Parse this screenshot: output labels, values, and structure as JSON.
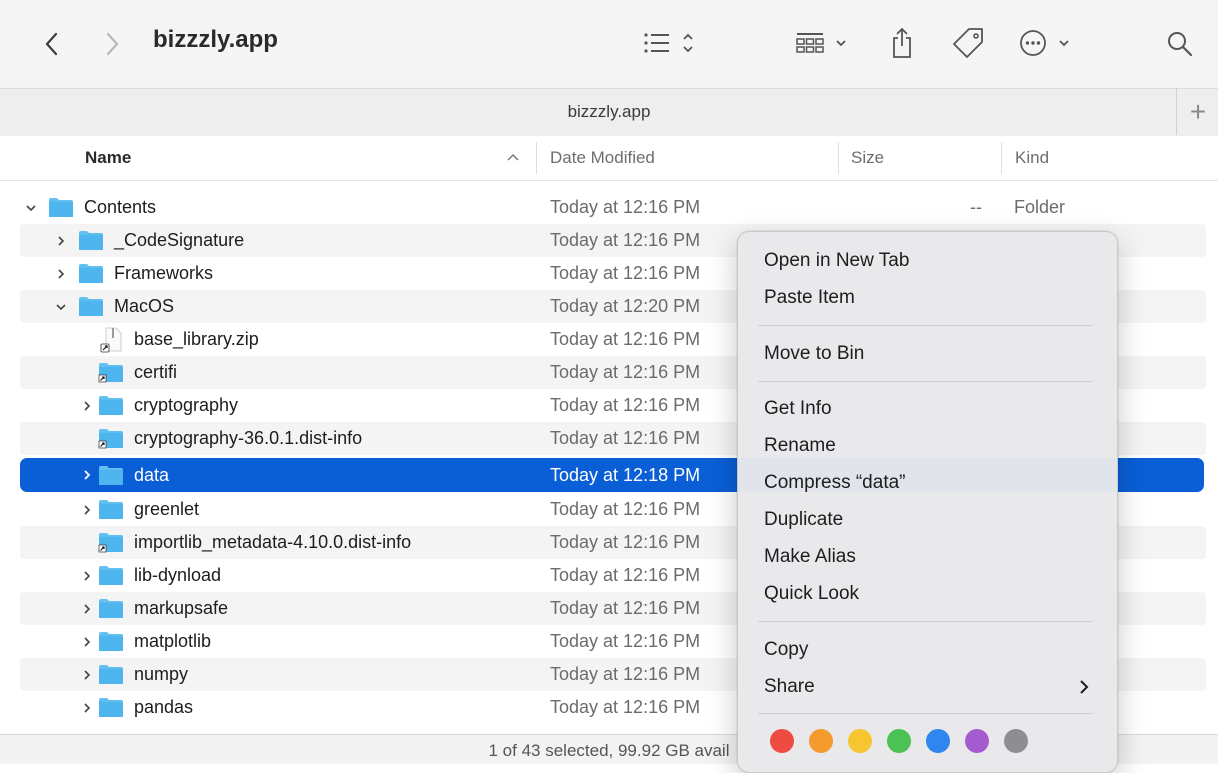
{
  "window": {
    "title": "bizzzly.app",
    "tab_title": "bizzzly.app"
  },
  "toolbar": {
    "back_icon": "chevron-left-icon",
    "forward_icon": "chevron-right-icon",
    "view_icon": "list-view-icon",
    "group_icon": "grid-group-icon",
    "share_icon": "share-icon",
    "tag_icon": "tag-icon",
    "more_icon": "ellipsis-circle-icon",
    "search_icon": "search-icon"
  },
  "columns": {
    "name": "Name",
    "date": "Date Modified",
    "size": "Size",
    "kind": "Kind"
  },
  "rows": [
    {
      "name": "Contents",
      "date": "Today at 12:16 PM",
      "size": "--",
      "kind": "Folder"
    },
    {
      "name": "_CodeSignature",
      "date": "Today at 12:16 PM"
    },
    {
      "name": "Frameworks",
      "date": "Today at 12:16 PM"
    },
    {
      "name": "MacOS",
      "date": "Today at 12:20 PM"
    },
    {
      "name": "base_library.zip",
      "date": "Today at 12:16 PM"
    },
    {
      "name": "certifi",
      "date": "Today at 12:16 PM"
    },
    {
      "name": "cryptography",
      "date": "Today at 12:16 PM"
    },
    {
      "name": "cryptography-36.0.1.dist-info",
      "date": "Today at 12:16 PM"
    },
    {
      "name": "data",
      "date": "Today at 12:18 PM"
    },
    {
      "name": "greenlet",
      "date": "Today at 12:16 PM"
    },
    {
      "name": "importlib_metadata-4.10.0.dist-info",
      "date": "Today at 12:16 PM"
    },
    {
      "name": "lib-dynload",
      "date": "Today at 12:16 PM"
    },
    {
      "name": "markupsafe",
      "date": "Today at 12:16 PM"
    },
    {
      "name": "matplotlib",
      "date": "Today at 12:16 PM"
    },
    {
      "name": "numpy",
      "date": "Today at 12:16 PM"
    },
    {
      "name": "pandas",
      "date": "Today at 12:16 PM"
    }
  ],
  "status": {
    "text": "1 of 43 selected, 99.92 GB avail"
  },
  "context_menu": {
    "items": [
      "Open in New Tab",
      "Paste Item",
      "Move to Bin",
      "Get Info",
      "Rename",
      "Compress “data”",
      "Duplicate",
      "Make Alias",
      "Quick Look",
      "Copy",
      "Share"
    ],
    "tag_colors": [
      "#ee4b43",
      "#f59a2d",
      "#f6c530",
      "#4cc154",
      "#2e86ee",
      "#a55bd0",
      "#8e8e92"
    ]
  }
}
